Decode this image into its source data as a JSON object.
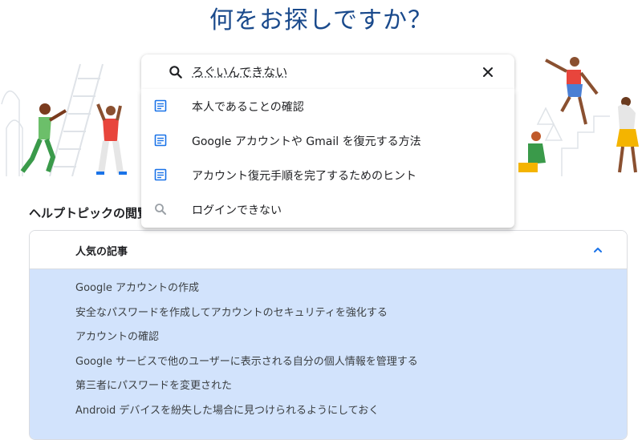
{
  "page": {
    "title": "何をお探しですか？"
  },
  "search": {
    "value": "ろぐいんできない",
    "icon": "search-icon",
    "clear_icon": "close-icon"
  },
  "suggestions": [
    {
      "icon": "article-icon",
      "label": "本人であることの確認"
    },
    {
      "icon": "article-icon",
      "label": "Google アカウントや Gmail を復元する方法"
    },
    {
      "icon": "article-icon",
      "label": "アカウント復元手順を完了するためのヒント"
    },
    {
      "icon": "search-icon",
      "label": "ログインできない"
    }
  ],
  "help_topics": {
    "title": "ヘルプトピックの閲覧",
    "popular": {
      "title": "人気の記事",
      "expanded": true,
      "articles": [
        "Google アカウントの作成",
        "安全なパスワードを作成してアカウントのセキュリティを強化する",
        "アカウントの確認",
        "Google サービスで他のユーザーに表示される自分の個人情報を管理する",
        "第三者にパスワードを変更された",
        "Android デバイスを紛失した場合に見つけられるようにしておく"
      ]
    }
  },
  "colors": {
    "title": "#1a4a8c",
    "accent": "#1a73e8",
    "panel_bg": "#d2e3fc"
  }
}
